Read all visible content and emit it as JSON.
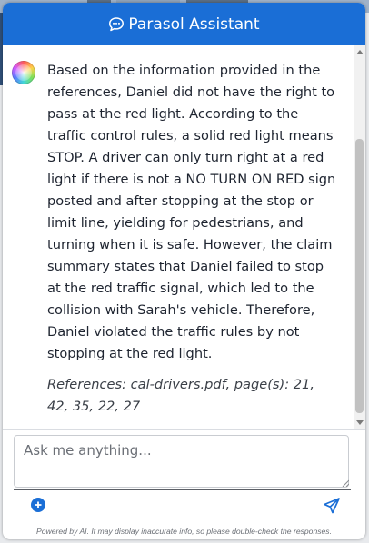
{
  "header": {
    "title": "Parasol Assistant",
    "icon": "chat-bubble-icon"
  },
  "conversation": {
    "assistant_message": {
      "avatar": "assistant-avatar",
      "body": "Based on the information provided in the references, Daniel did not have the right to pass at the red light. According to the traffic control rules, a solid red light means STOP. A driver can only turn right at a red light if there is not a NO TURN ON RED sign posted and after stopping at the stop or limit line, yielding for pedestrians, and turning when it is safe. However, the claim summary states that Daniel failed to stop at the red traffic signal, which led to the collision with Sarah's vehicle. Therefore, Daniel violated the traffic rules by not stopping at the red light.",
      "references": "References: cal-drivers.pdf, page(s): 21, 42, 35, 22, 27"
    }
  },
  "composer": {
    "placeholder": "Ask me anything...",
    "value": "",
    "attach_icon": "plus-circle-icon",
    "send_icon": "send-icon"
  },
  "footer": {
    "disclaimer": "Powered by AI. It may display inaccurate info, so please double-check the responses."
  },
  "colors": {
    "brand": "#1a6ed6",
    "text": "#1e2430"
  }
}
